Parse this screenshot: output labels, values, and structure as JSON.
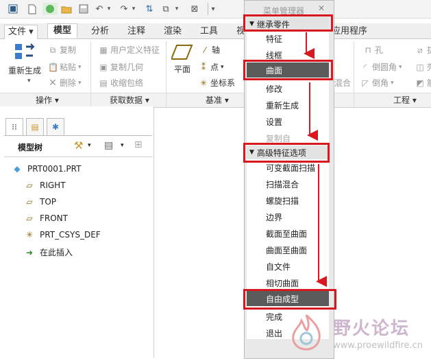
{
  "tabs": [
    "文件",
    "模型",
    "分析",
    "注释",
    "渲染",
    "工具",
    "视",
    "应用程序"
  ],
  "ribbon": {
    "regen": "重新生成",
    "copy": "复制",
    "paste": "粘贴",
    "delete": "删除",
    "udf": "用户定义特征",
    "copy_geom": "复制几何",
    "shrinkwrap": "收缩包络",
    "plane": "平面",
    "axis": "轴",
    "point": "点",
    "csys": "坐标系",
    "hole": "孔",
    "round": "倒圆角",
    "chamfer": "倒角",
    "blend": "混合",
    "right_cut1": "拔",
    "right_cut2": "壳",
    "right_cut3": "筋"
  },
  "groups": {
    "ops": "操作",
    "getdata": "获取数据",
    "datum": "基准",
    "eng": "工程"
  },
  "panel": {
    "title": "模型树",
    "items": [
      "PRT0001.PRT",
      "RIGHT",
      "TOP",
      "FRONT",
      "PRT_CSYS_DEF",
      "在此插入"
    ]
  },
  "menu": {
    "title": "菜单管理器",
    "header1": "继承零件",
    "items_a": [
      "特征",
      "线框"
    ],
    "selected1": "曲面",
    "items_b": [
      "修改",
      "重新生成",
      "设置",
      "复制自"
    ],
    "header2": "高级特征选项",
    "items_c": [
      "可变截面扫描",
      "扫描混合",
      "螺旋扫描",
      "边界",
      "截面至曲面",
      "曲面至曲面",
      "自文件",
      "相切曲面"
    ],
    "selected2": "自由成型",
    "items_d": [
      "完成",
      "退出"
    ]
  },
  "watermark": {
    "title": "野火论坛",
    "url": "www.proewildfire.cn"
  },
  "colors": {
    "annotation_red": "#d9171e",
    "selected_bg": "#5b5b5b"
  }
}
